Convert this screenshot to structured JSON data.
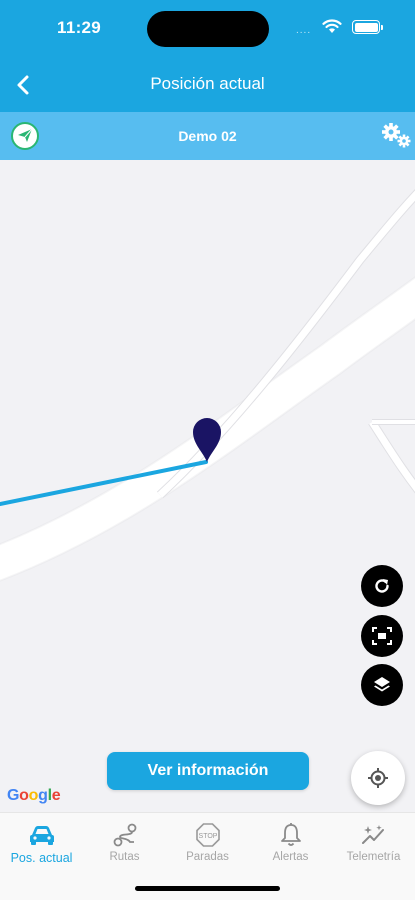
{
  "status_bar": {
    "time": "11:29",
    "dots": "....",
    "icons": [
      "wifi-icon",
      "battery-icon"
    ]
  },
  "header": {
    "title": "Posición actual",
    "back_icon": "chevron-left-icon"
  },
  "vehicle_bar": {
    "name": "Demo 02",
    "vehicle_icon": "navigation-arrow-icon",
    "settings_icon": "gears-icon"
  },
  "map": {
    "provider_logo": [
      "G",
      "o",
      "o",
      "g",
      "l",
      "e"
    ],
    "logo_colors": [
      "#4285F4",
      "#EA4335",
      "#FBBC05",
      "#4285F4",
      "#34A853",
      "#EA4335"
    ],
    "route_color": "#1ba6e0",
    "marker_color": "#1a1464",
    "controls": [
      "refresh-icon",
      "fit-bounds-icon",
      "layers-icon"
    ],
    "locate_icon": "my-location-icon"
  },
  "actions": {
    "info_button": "Ver información"
  },
  "tabs": [
    {
      "label": "Pos. actual",
      "icon": "car-icon",
      "active": true
    },
    {
      "label": "Rutas",
      "icon": "route-icon",
      "active": false
    },
    {
      "label": "Paradas",
      "icon": "stop-sign-icon",
      "active": false
    },
    {
      "label": "Alertas",
      "icon": "bell-icon",
      "active": false
    },
    {
      "label": "Telemetría",
      "icon": "telemetry-icon",
      "active": false
    }
  ],
  "colors": {
    "primary": "#1ba6e0",
    "subbar": "#57bdf0",
    "inactive": "#a6a6a6"
  }
}
